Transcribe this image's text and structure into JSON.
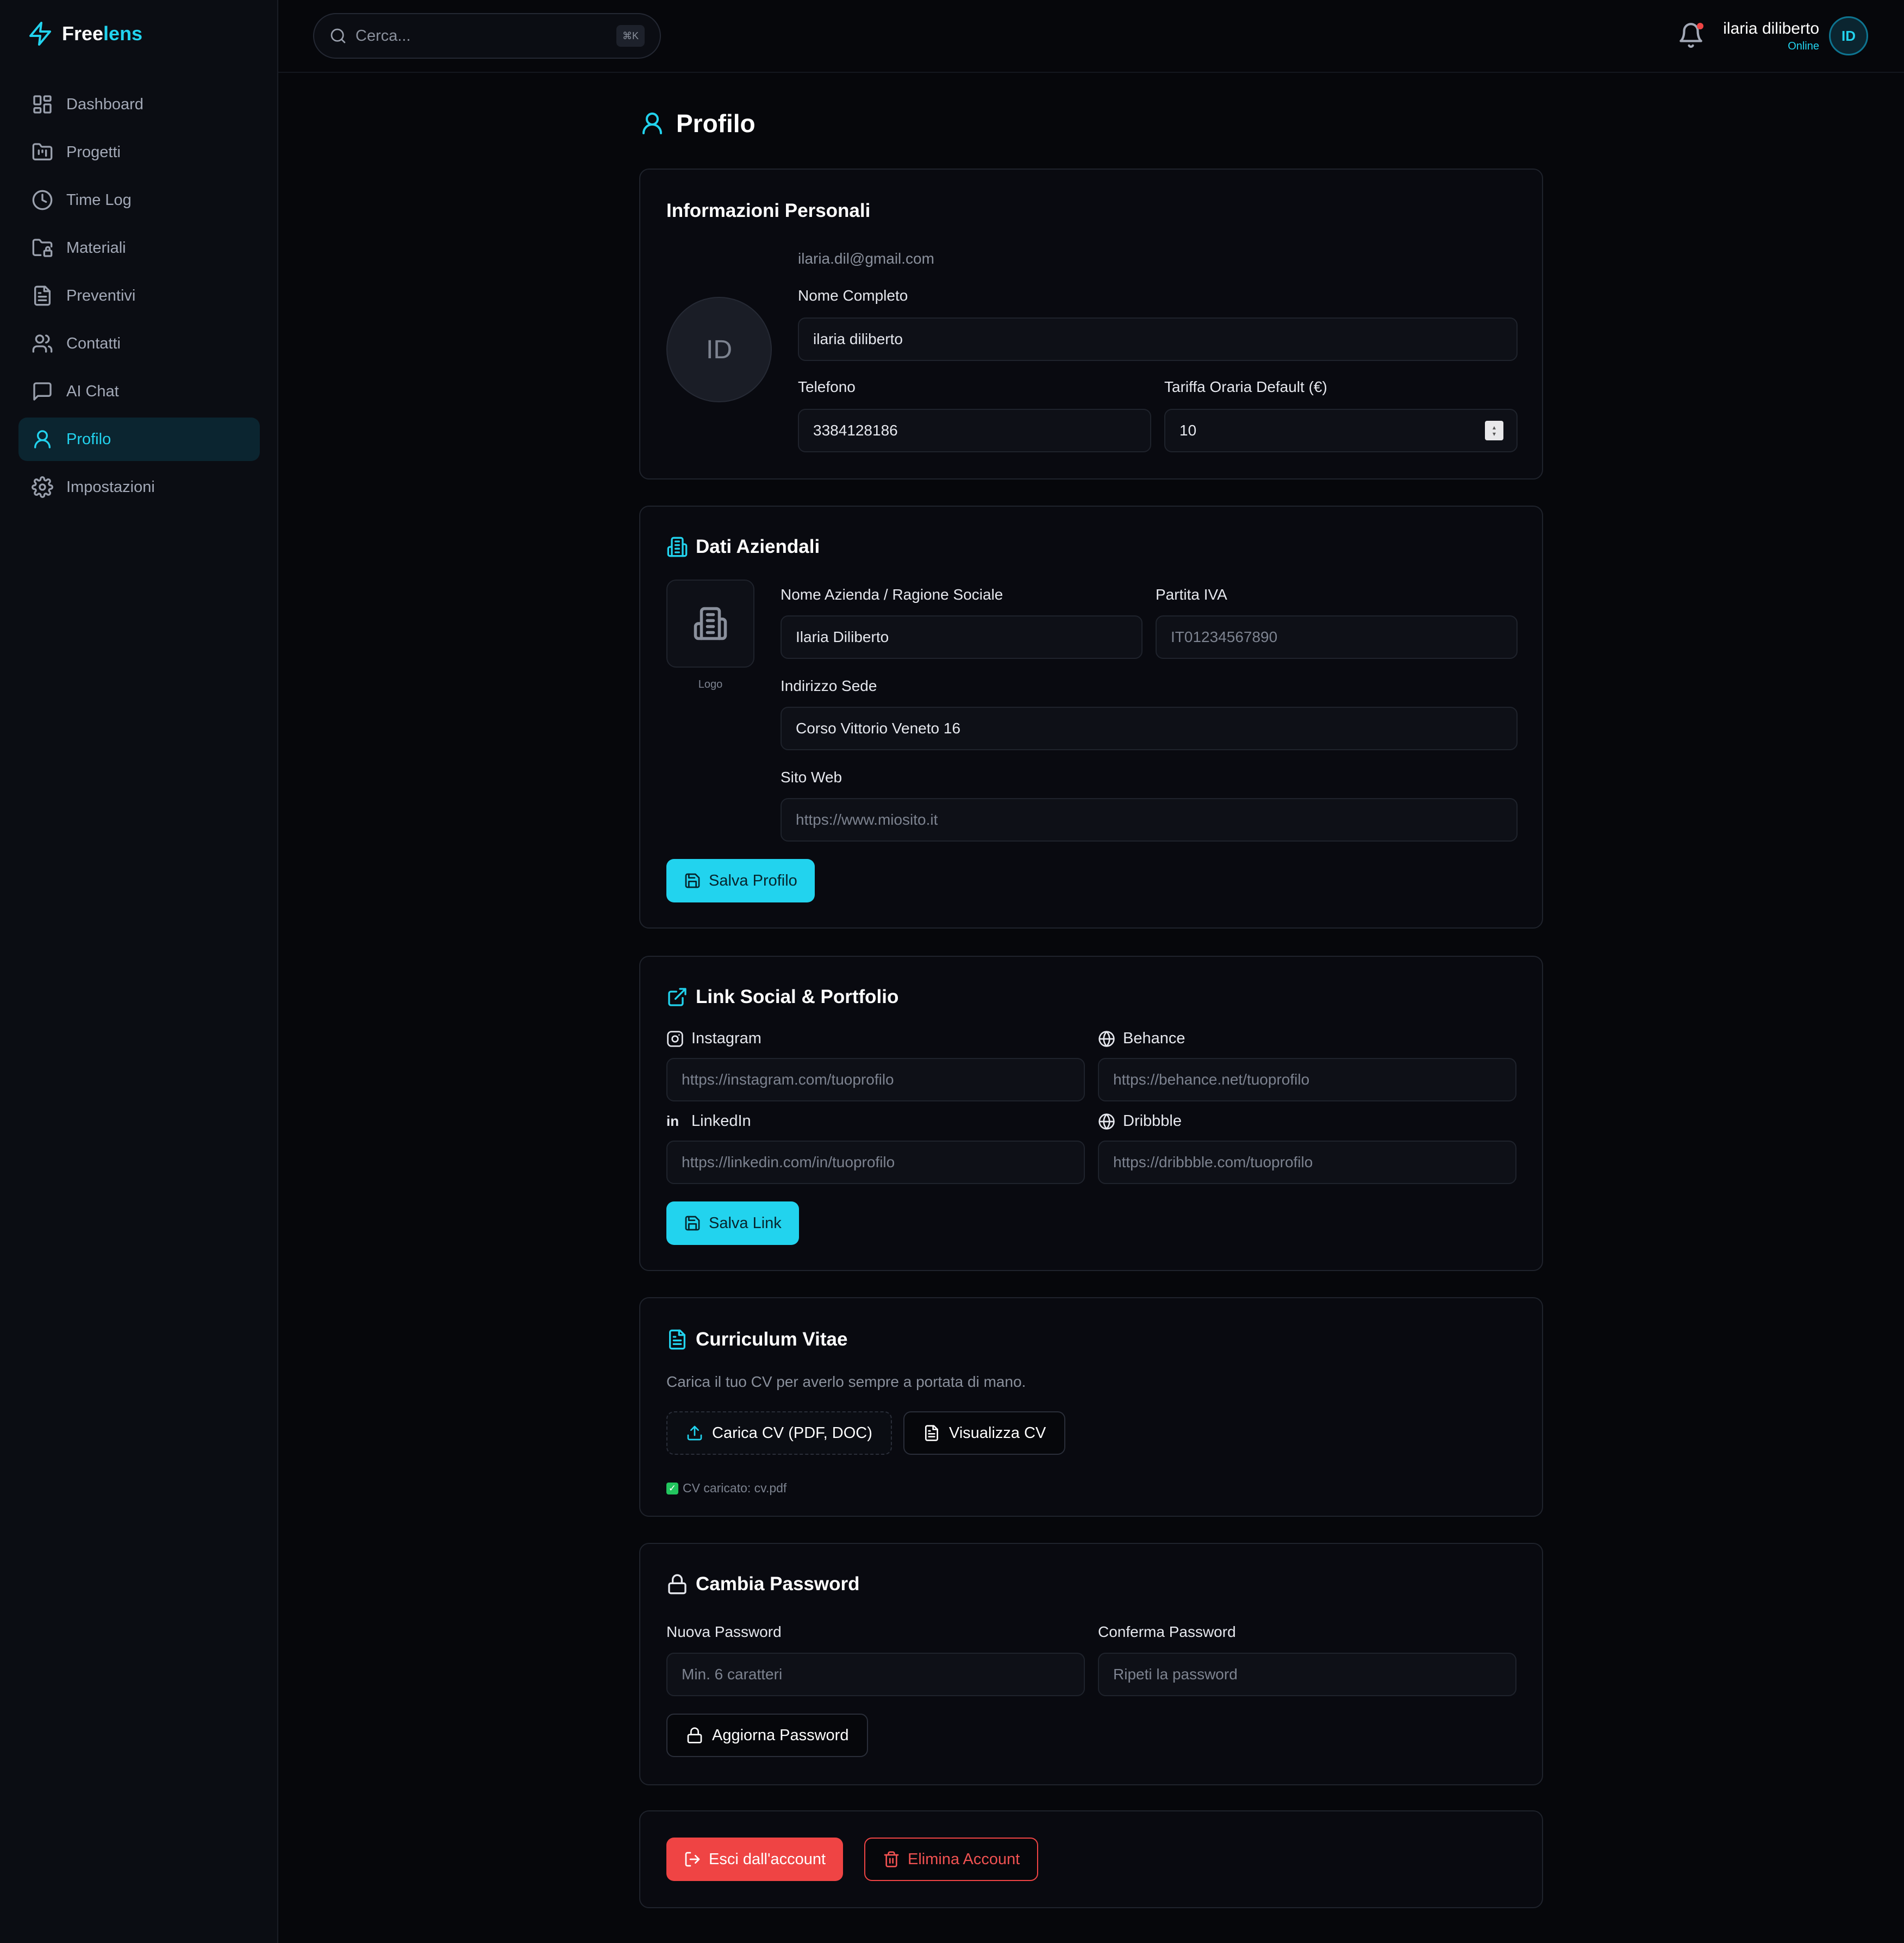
{
  "app": {
    "brand_prefix": "Free",
    "brand_suffix": "lens"
  },
  "sidebar": {
    "items": [
      {
        "label": "Dashboard",
        "icon": "dashboard-icon"
      },
      {
        "label": "Progetti",
        "icon": "folder-kanban-icon"
      },
      {
        "label": "Time Log",
        "icon": "clock-icon"
      },
      {
        "label": "Materiali",
        "icon": "folder-lock-icon"
      },
      {
        "label": "Preventivi",
        "icon": "file-text-icon"
      },
      {
        "label": "Contatti",
        "icon": "users-icon"
      },
      {
        "label": "AI Chat",
        "icon": "message-square-icon"
      },
      {
        "label": "Profilo",
        "icon": "user-icon",
        "active": true
      },
      {
        "label": "Impostazioni",
        "icon": "settings-icon"
      }
    ]
  },
  "topbar": {
    "search_placeholder": "Cerca...",
    "search_shortcut": "⌘K",
    "user_name": "ilaria diliberto",
    "user_status": "Online",
    "user_initials": "ID"
  },
  "page": {
    "title": "Profilo"
  },
  "personal": {
    "title": "Informazioni Personali",
    "initials": "ID",
    "email": "ilaria.dil@gmail.com",
    "name_label": "Nome Completo",
    "name_value": "ilaria diliberto",
    "phone_label": "Telefono",
    "phone_value": "3384128186",
    "rate_label": "Tariffa Oraria Default (€)",
    "rate_value": "10"
  },
  "company": {
    "title": "Dati Aziendali",
    "logo_caption": "Logo",
    "name_label": "Nome Azienda / Ragione Sociale",
    "name_value": "Ilaria Diliberto",
    "vat_label": "Partita IVA",
    "vat_placeholder": "IT01234567890",
    "address_label": "Indirizzo Sede",
    "address_value": "Corso Vittorio Veneto 16",
    "website_label": "Sito Web",
    "website_placeholder": "https://www.miosito.it",
    "save_label": "Salva Profilo"
  },
  "social": {
    "title": "Link Social & Portfolio",
    "instagram_label": "Instagram",
    "instagram_placeholder": "https://instagram.com/tuoprofilo",
    "behance_label": "Behance",
    "behance_placeholder": "https://behance.net/tuoprofilo",
    "linkedin_badge": "in",
    "linkedin_label": "LinkedIn",
    "linkedin_placeholder": "https://linkedin.com/in/tuoprofilo",
    "dribbble_label": "Dribbble",
    "dribbble_placeholder": "https://dribbble.com/tuoprofilo",
    "save_label": "Salva Link"
  },
  "cv": {
    "title": "Curriculum Vitae",
    "description": "Carica il tuo CV per averlo sempre a portata di mano.",
    "upload_label": "Carica CV (PDF, DOC)",
    "view_label": "Visualizza CV",
    "check_mark": "✓",
    "status": "CV caricato: cv.pdf"
  },
  "password": {
    "title": "Cambia Password",
    "new_label": "Nuova Password",
    "new_placeholder": "Min. 6 caratteri",
    "confirm_label": "Conferma Password",
    "confirm_placeholder": "Ripeti la password",
    "update_label": "Aggiorna Password"
  },
  "account": {
    "logout_label": "Esci dall'account",
    "delete_label": "Elimina Account"
  },
  "colors": {
    "accent": "#22d3ee",
    "danger": "#ef4444",
    "background": "#06070b",
    "success": "#22c55e"
  }
}
